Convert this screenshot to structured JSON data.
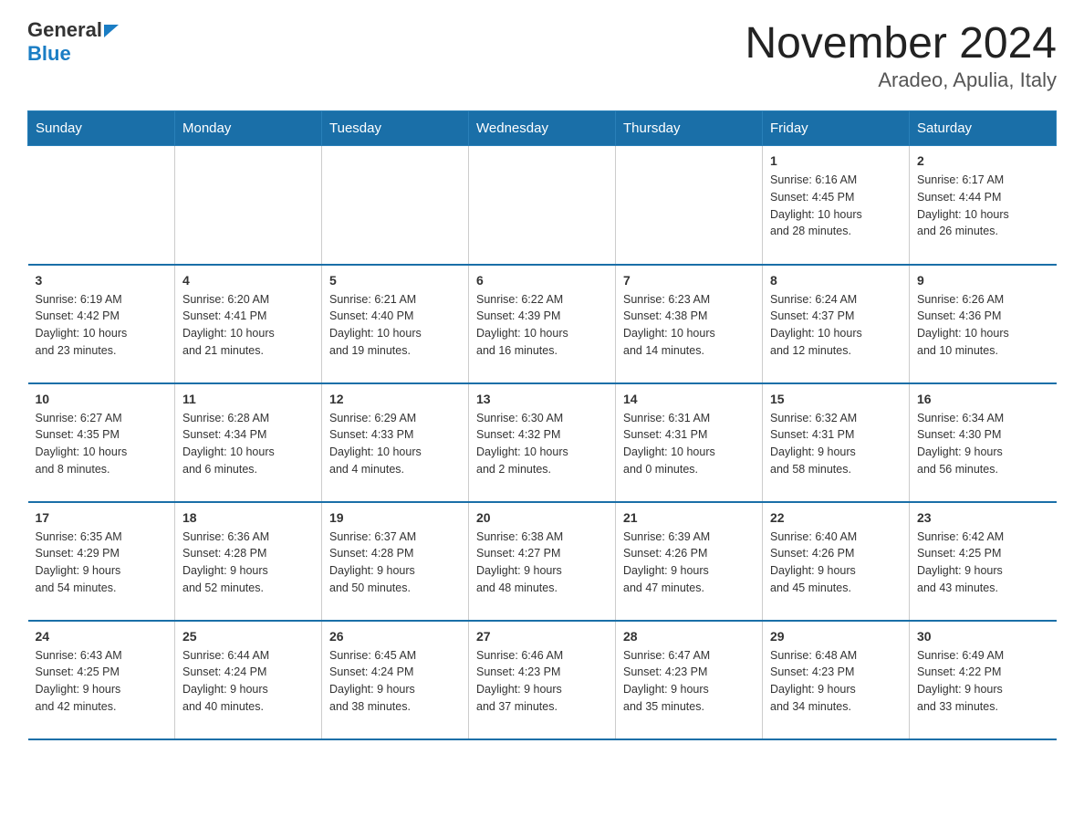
{
  "header": {
    "logo_general": "General",
    "logo_blue": "Blue",
    "title": "November 2024",
    "subtitle": "Aradeo, Apulia, Italy"
  },
  "days_of_week": [
    "Sunday",
    "Monday",
    "Tuesday",
    "Wednesday",
    "Thursday",
    "Friday",
    "Saturday"
  ],
  "weeks": [
    {
      "days": [
        {
          "num": "",
          "info": ""
        },
        {
          "num": "",
          "info": ""
        },
        {
          "num": "",
          "info": ""
        },
        {
          "num": "",
          "info": ""
        },
        {
          "num": "",
          "info": ""
        },
        {
          "num": "1",
          "info": "Sunrise: 6:16 AM\nSunset: 4:45 PM\nDaylight: 10 hours\nand 28 minutes."
        },
        {
          "num": "2",
          "info": "Sunrise: 6:17 AM\nSunset: 4:44 PM\nDaylight: 10 hours\nand 26 minutes."
        }
      ]
    },
    {
      "days": [
        {
          "num": "3",
          "info": "Sunrise: 6:19 AM\nSunset: 4:42 PM\nDaylight: 10 hours\nand 23 minutes."
        },
        {
          "num": "4",
          "info": "Sunrise: 6:20 AM\nSunset: 4:41 PM\nDaylight: 10 hours\nand 21 minutes."
        },
        {
          "num": "5",
          "info": "Sunrise: 6:21 AM\nSunset: 4:40 PM\nDaylight: 10 hours\nand 19 minutes."
        },
        {
          "num": "6",
          "info": "Sunrise: 6:22 AM\nSunset: 4:39 PM\nDaylight: 10 hours\nand 16 minutes."
        },
        {
          "num": "7",
          "info": "Sunrise: 6:23 AM\nSunset: 4:38 PM\nDaylight: 10 hours\nand 14 minutes."
        },
        {
          "num": "8",
          "info": "Sunrise: 6:24 AM\nSunset: 4:37 PM\nDaylight: 10 hours\nand 12 minutes."
        },
        {
          "num": "9",
          "info": "Sunrise: 6:26 AM\nSunset: 4:36 PM\nDaylight: 10 hours\nand 10 minutes."
        }
      ]
    },
    {
      "days": [
        {
          "num": "10",
          "info": "Sunrise: 6:27 AM\nSunset: 4:35 PM\nDaylight: 10 hours\nand 8 minutes."
        },
        {
          "num": "11",
          "info": "Sunrise: 6:28 AM\nSunset: 4:34 PM\nDaylight: 10 hours\nand 6 minutes."
        },
        {
          "num": "12",
          "info": "Sunrise: 6:29 AM\nSunset: 4:33 PM\nDaylight: 10 hours\nand 4 minutes."
        },
        {
          "num": "13",
          "info": "Sunrise: 6:30 AM\nSunset: 4:32 PM\nDaylight: 10 hours\nand 2 minutes."
        },
        {
          "num": "14",
          "info": "Sunrise: 6:31 AM\nSunset: 4:31 PM\nDaylight: 10 hours\nand 0 minutes."
        },
        {
          "num": "15",
          "info": "Sunrise: 6:32 AM\nSunset: 4:31 PM\nDaylight: 9 hours\nand 58 minutes."
        },
        {
          "num": "16",
          "info": "Sunrise: 6:34 AM\nSunset: 4:30 PM\nDaylight: 9 hours\nand 56 minutes."
        }
      ]
    },
    {
      "days": [
        {
          "num": "17",
          "info": "Sunrise: 6:35 AM\nSunset: 4:29 PM\nDaylight: 9 hours\nand 54 minutes."
        },
        {
          "num": "18",
          "info": "Sunrise: 6:36 AM\nSunset: 4:28 PM\nDaylight: 9 hours\nand 52 minutes."
        },
        {
          "num": "19",
          "info": "Sunrise: 6:37 AM\nSunset: 4:28 PM\nDaylight: 9 hours\nand 50 minutes."
        },
        {
          "num": "20",
          "info": "Sunrise: 6:38 AM\nSunset: 4:27 PM\nDaylight: 9 hours\nand 48 minutes."
        },
        {
          "num": "21",
          "info": "Sunrise: 6:39 AM\nSunset: 4:26 PM\nDaylight: 9 hours\nand 47 minutes."
        },
        {
          "num": "22",
          "info": "Sunrise: 6:40 AM\nSunset: 4:26 PM\nDaylight: 9 hours\nand 45 minutes."
        },
        {
          "num": "23",
          "info": "Sunrise: 6:42 AM\nSunset: 4:25 PM\nDaylight: 9 hours\nand 43 minutes."
        }
      ]
    },
    {
      "days": [
        {
          "num": "24",
          "info": "Sunrise: 6:43 AM\nSunset: 4:25 PM\nDaylight: 9 hours\nand 42 minutes."
        },
        {
          "num": "25",
          "info": "Sunrise: 6:44 AM\nSunset: 4:24 PM\nDaylight: 9 hours\nand 40 minutes."
        },
        {
          "num": "26",
          "info": "Sunrise: 6:45 AM\nSunset: 4:24 PM\nDaylight: 9 hours\nand 38 minutes."
        },
        {
          "num": "27",
          "info": "Sunrise: 6:46 AM\nSunset: 4:23 PM\nDaylight: 9 hours\nand 37 minutes."
        },
        {
          "num": "28",
          "info": "Sunrise: 6:47 AM\nSunset: 4:23 PM\nDaylight: 9 hours\nand 35 minutes."
        },
        {
          "num": "29",
          "info": "Sunrise: 6:48 AM\nSunset: 4:23 PM\nDaylight: 9 hours\nand 34 minutes."
        },
        {
          "num": "30",
          "info": "Sunrise: 6:49 AM\nSunset: 4:22 PM\nDaylight: 9 hours\nand 33 minutes."
        }
      ]
    }
  ]
}
